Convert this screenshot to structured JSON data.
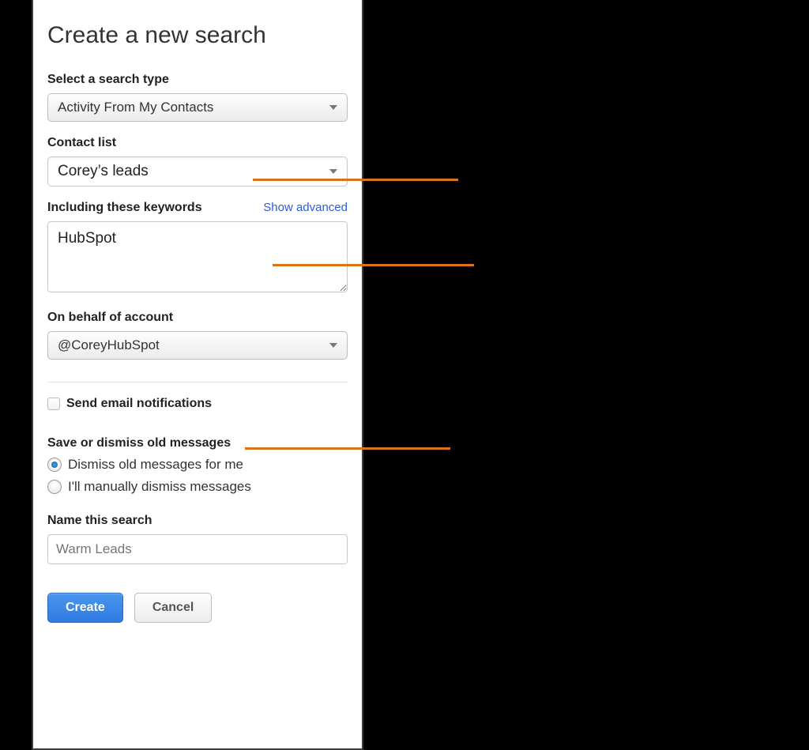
{
  "title": "Create a new search",
  "searchType": {
    "label": "Select a search type",
    "value": "Activity From My Contacts"
  },
  "contactList": {
    "label": "Contact list",
    "value": "Corey’s leads"
  },
  "keywords": {
    "label": "Including these keywords",
    "advancedLink": "Show advanced",
    "value": "HubSpot"
  },
  "account": {
    "label": "On behalf of account",
    "value": "@CoreyHubSpot"
  },
  "emailNotifications": {
    "label": "Send email notifications",
    "checked": false
  },
  "dismiss": {
    "label": "Save or dismiss old messages",
    "option1": "Dismiss old messages for me",
    "option2": "I'll manually dismiss messages",
    "selected": "option1"
  },
  "nameSearch": {
    "label": "Name this search",
    "placeholder": "Warm Leads"
  },
  "buttons": {
    "create": "Create",
    "cancel": "Cancel"
  }
}
